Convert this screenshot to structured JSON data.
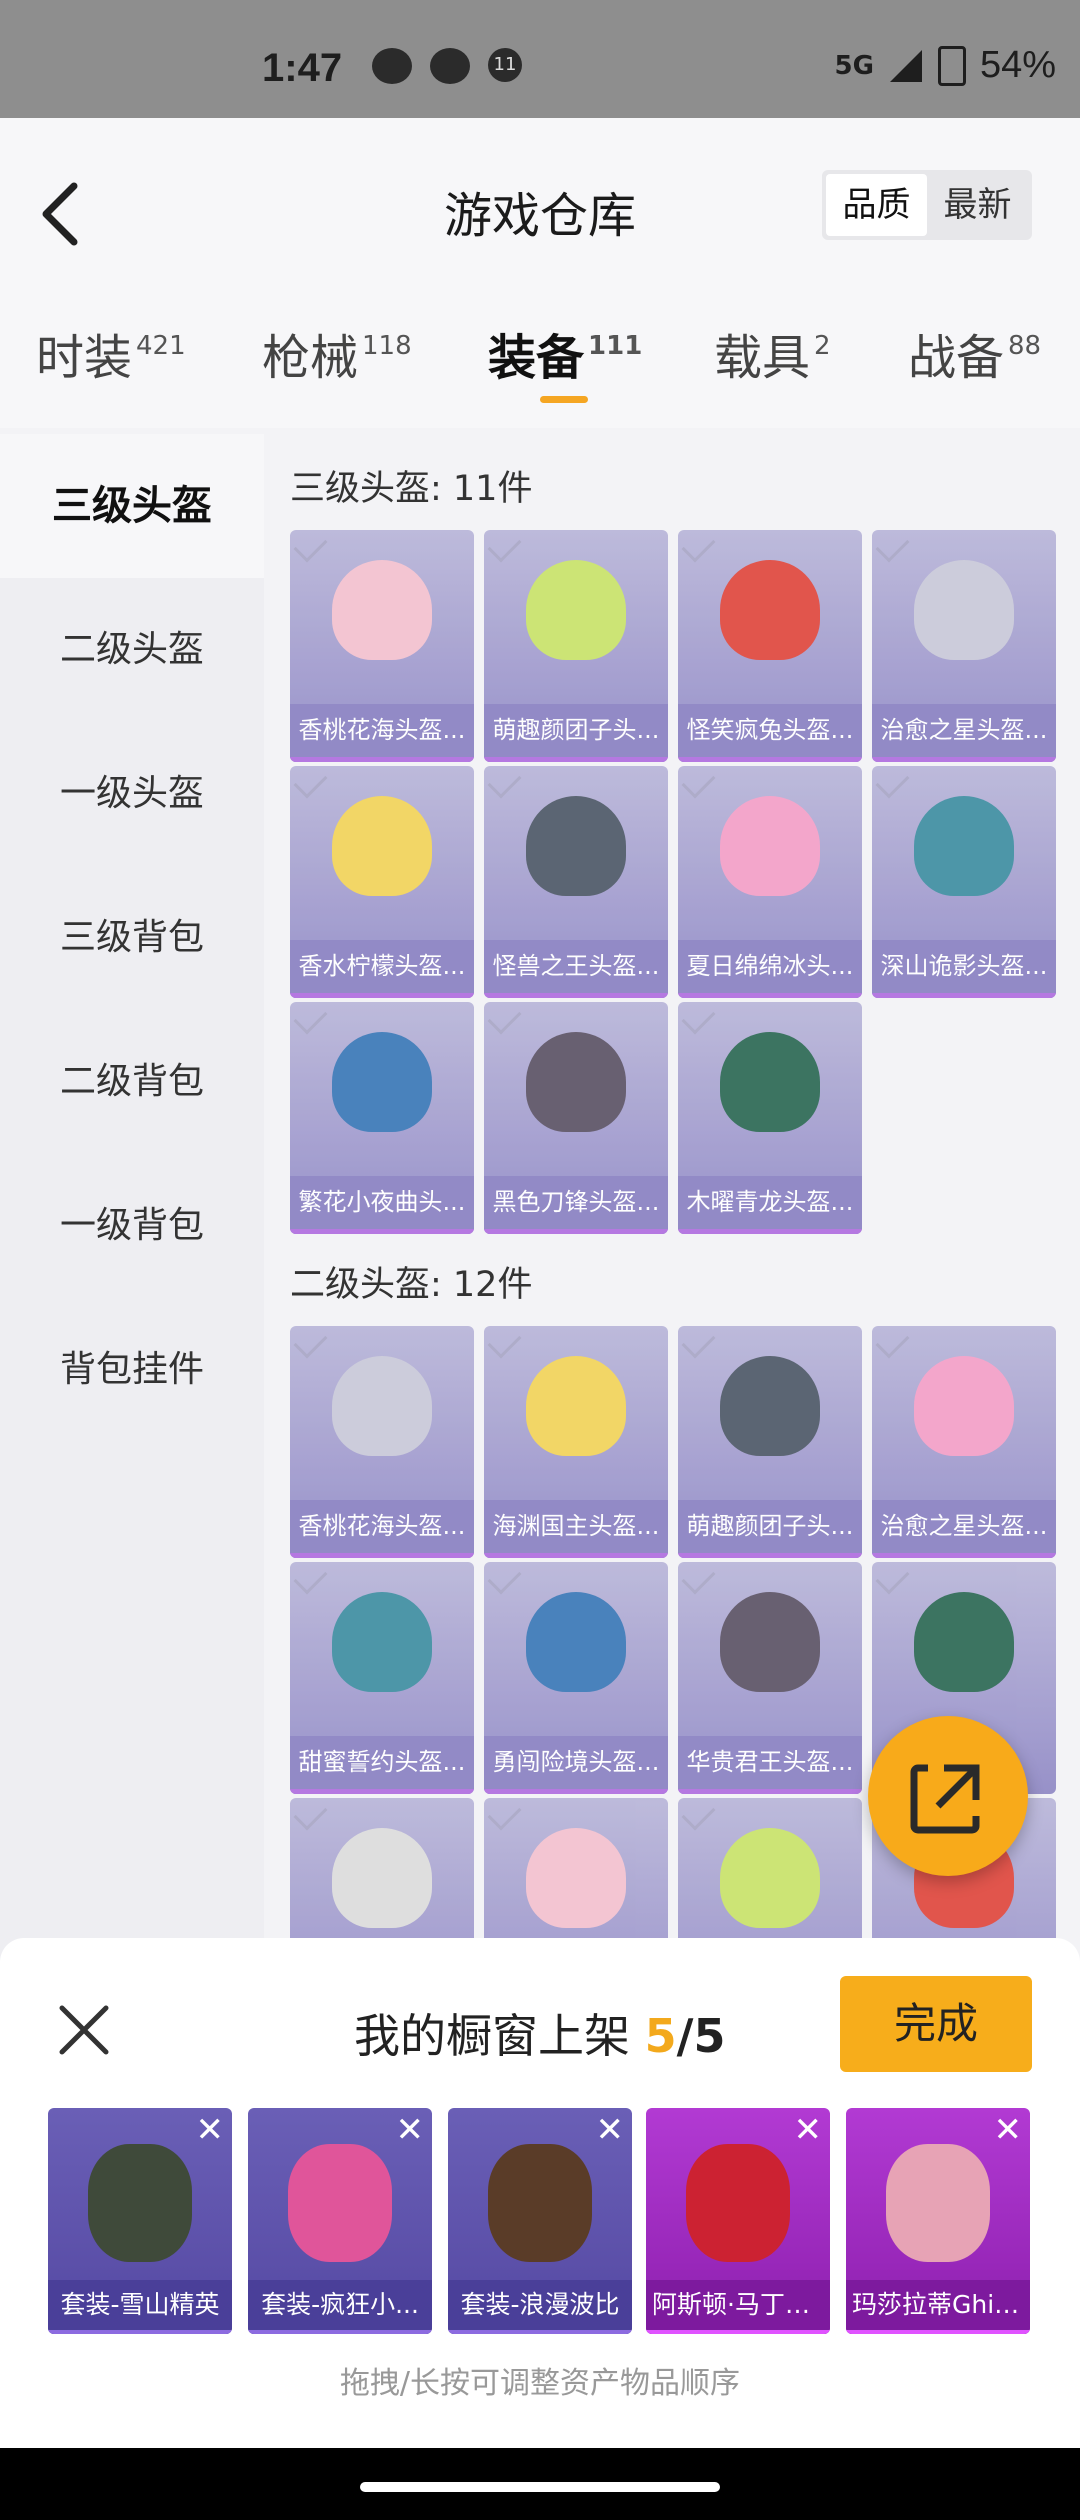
{
  "status": {
    "time": "1:47",
    "notif_count": "11",
    "network": "5G",
    "battery": "54%"
  },
  "header": {
    "title": "游戏仓库",
    "sort_quality": "品质",
    "sort_newest": "最新"
  },
  "tabs": [
    {
      "label": "时装",
      "count": "421"
    },
    {
      "label": "枪械",
      "count": "118"
    },
    {
      "label": "装备",
      "count": "111"
    },
    {
      "label": "载具",
      "count": "2"
    },
    {
      "label": "战备",
      "count": "88"
    }
  ],
  "sidebar": [
    "三级头盔",
    "二级头盔",
    "一级头盔",
    "三级背包",
    "二级背包",
    "一级背包",
    "背包挂件"
  ],
  "sections": [
    {
      "title": "三级头盔: 11件",
      "items": [
        "香桃花海头盔...",
        "萌趣颜团子头...",
        "怪笑疯兔头盔...",
        "治愈之星头盔...",
        "香水柠檬头盔...",
        "怪兽之王头盔...",
        "夏日绵绵冰头...",
        "深山诡影头盔...",
        "繁花小夜曲头...",
        "黑色刀锋头盔...",
        "木曜青龙头盔..."
      ]
    },
    {
      "title": "二级头盔: 12件",
      "items": [
        "香桃花海头盔...",
        "海渊国主头盔...",
        "萌趣颜团子头...",
        "治愈之星头盔...",
        "甜蜜誓约头盔...",
        "勇闯险境头盔...",
        "华贵君王头盔...",
        "",
        "",
        "",
        "",
        ""
      ]
    }
  ],
  "panel": {
    "title": "我的橱窗上架 ",
    "current": "5",
    "sep_total": "/5",
    "done": "完成",
    "items": [
      "套装-雪山精英",
      "套装-疯狂小...",
      "套装-浪漫波比",
      "阿斯顿·马丁D...",
      "玛莎拉蒂Ghib..."
    ],
    "hint": "拖拽/长按可调整资产物品顺序"
  },
  "colors": {
    "accent": "#f5a623",
    "card_purple": "#9d97cc",
    "card_magenta": "#8d1fae"
  }
}
